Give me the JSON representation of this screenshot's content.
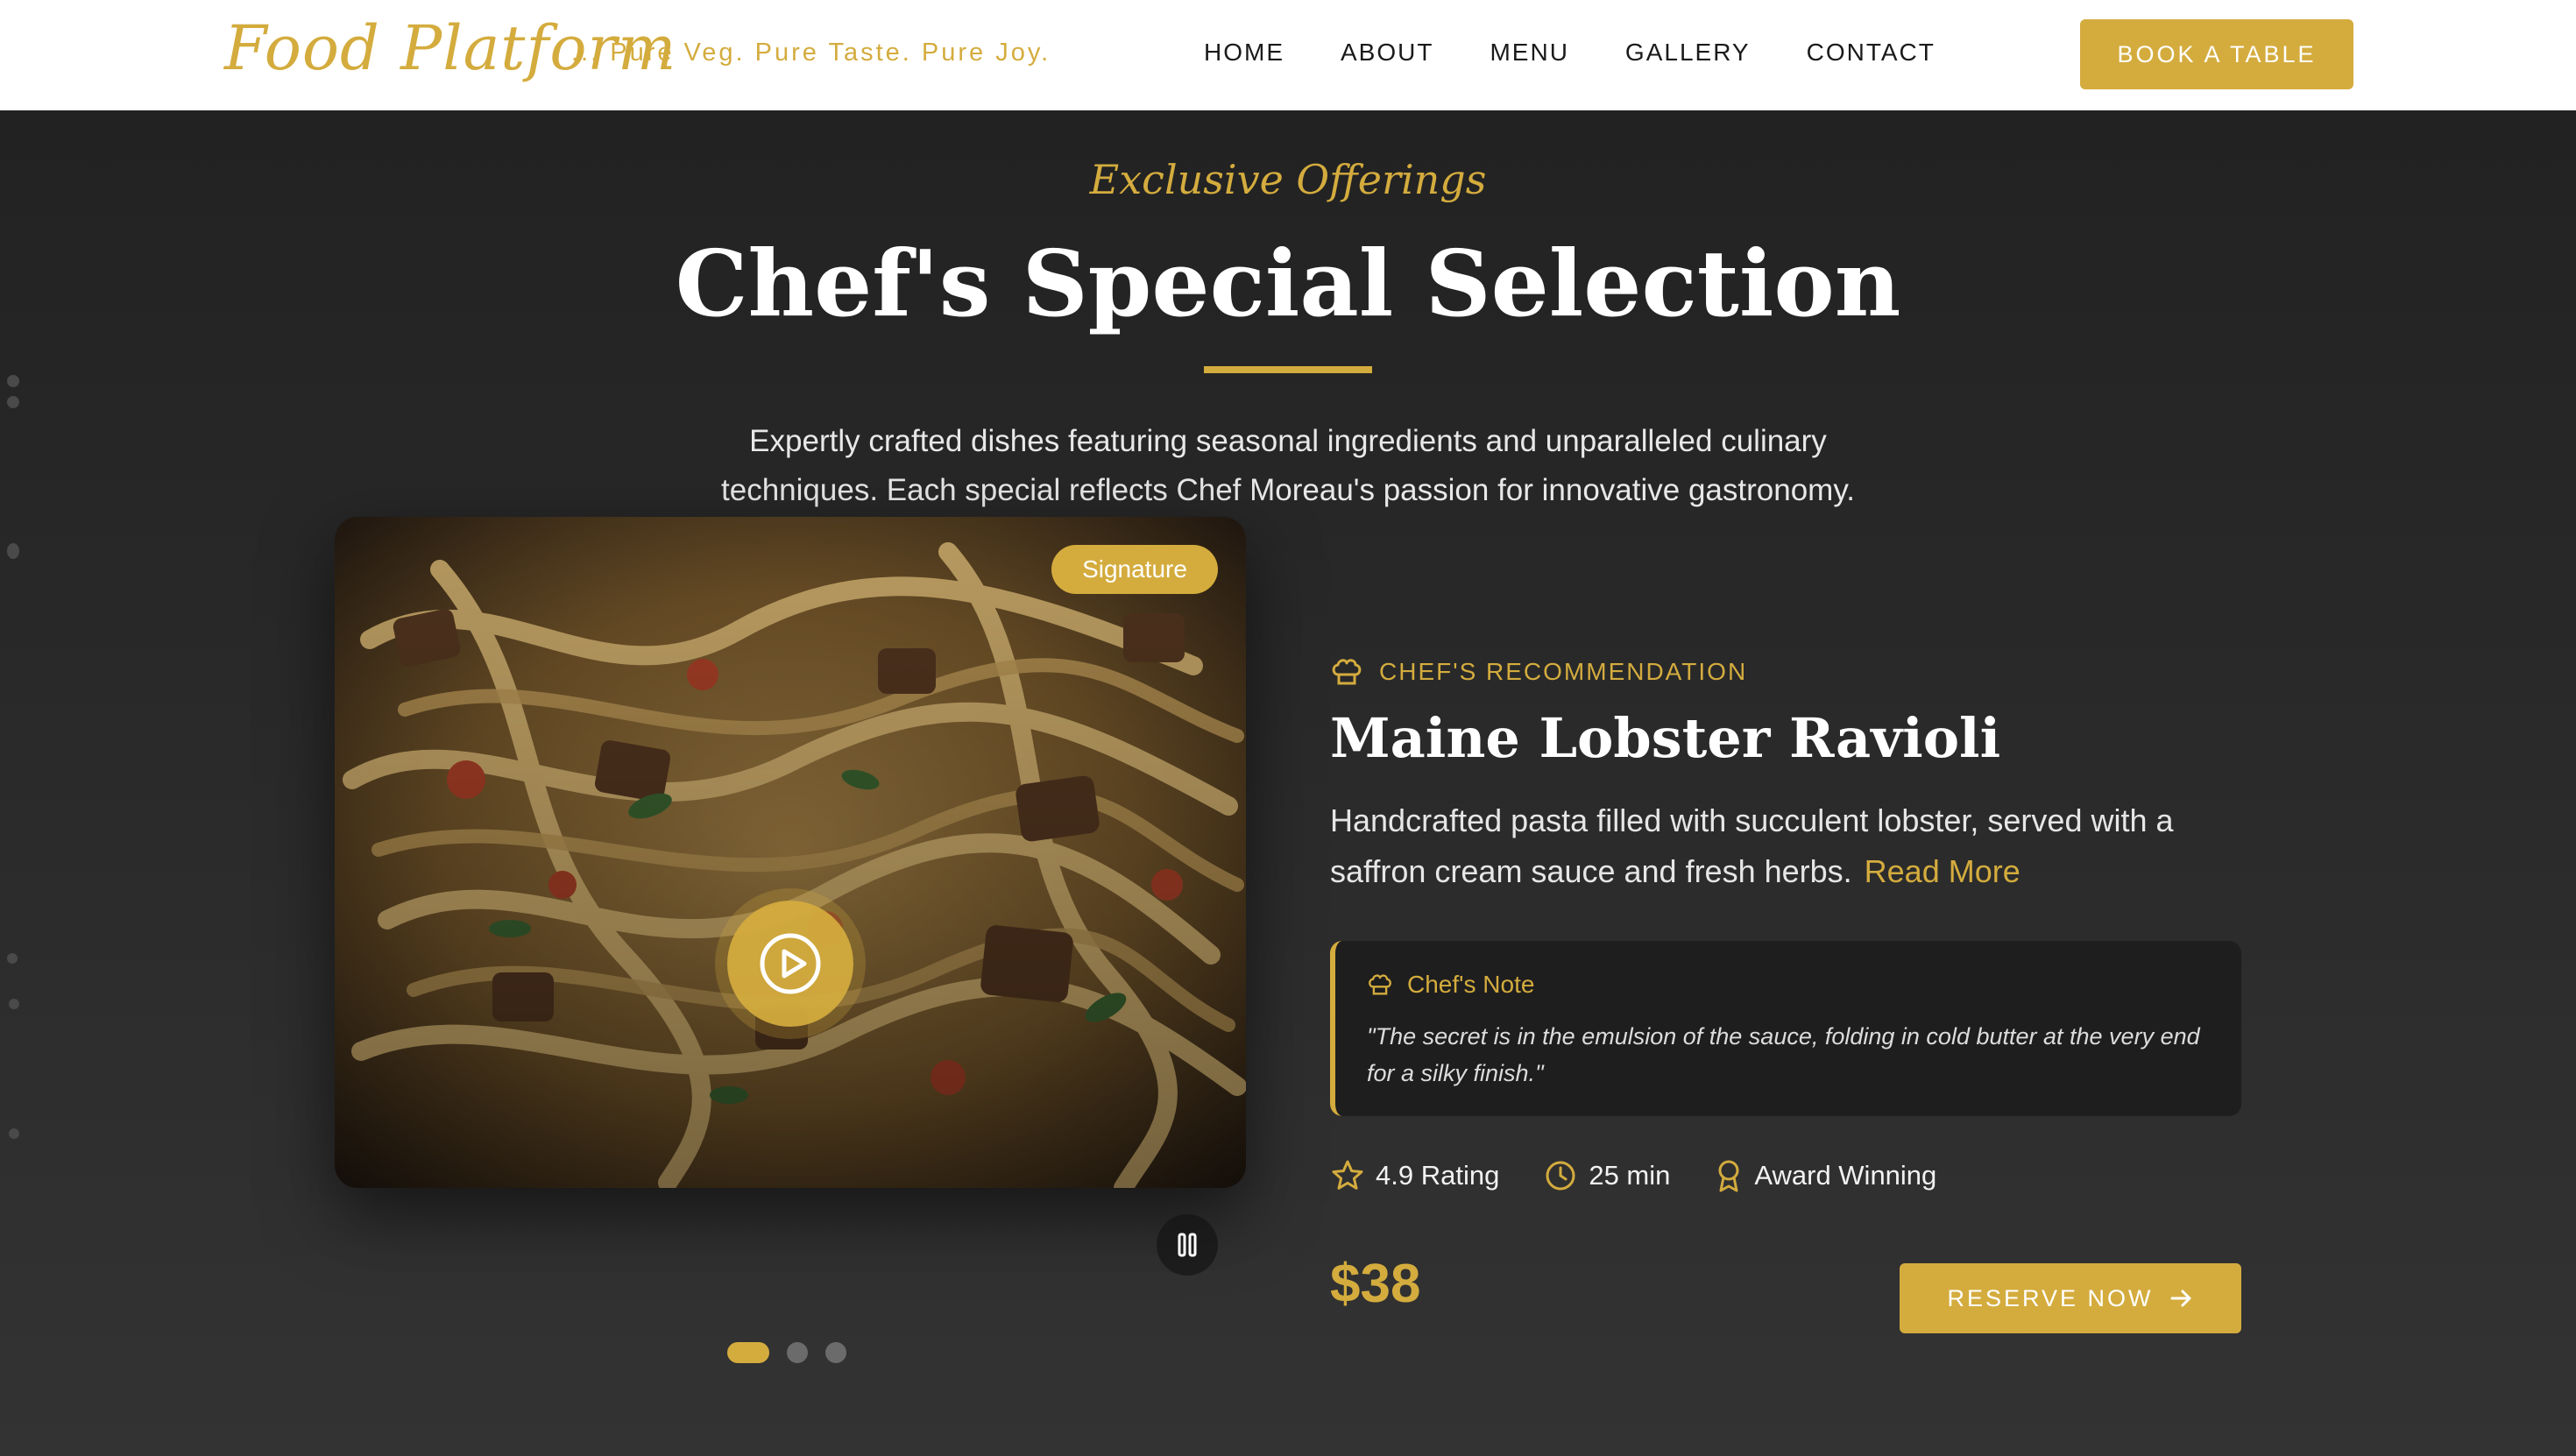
{
  "nav": {
    "logo": "Food Platform",
    "tagline": "... Pure Veg. Pure Taste. Pure Joy.",
    "links": [
      "HOME",
      "ABOUT",
      "MENU",
      "GALLERY",
      "CONTACT"
    ],
    "cta": "BOOK A TABLE"
  },
  "hero": {
    "eyebrow": "Exclusive Offerings",
    "title": "Chef's Special Selection",
    "intro": "Expertly crafted dishes featuring seasonal ingredients and unparalleled culinary techniques. Each special reflects Chef Moreau's passion for innovative gastronomy."
  },
  "media": {
    "badge": "Signature",
    "play_icon": "play-circle-icon",
    "pause_icon": "pause-icon",
    "slide_count": 3,
    "active_slide": 1
  },
  "dish": {
    "recommendation": "CHEF'S RECOMMENDATION",
    "name": "Maine Lobster Ravioli",
    "description": "Handcrafted pasta filled with succulent lobster, served with a saffron cream sauce and fresh herbs.",
    "read_more": "Read More",
    "note_title": "Chef's Note",
    "note_text": "\"The secret is in the emulsion of the sauce, folding in cold butter at the very end for a silky finish.\"",
    "stats": {
      "rating": "4.9 Rating",
      "time": "25 min",
      "award": "Award Winning"
    },
    "price": "$38",
    "reserve": "RESERVE NOW"
  },
  "colors": {
    "accent": "#d4ac3e",
    "background": "#2a2a2a",
    "nav_bg": "#ffffff"
  }
}
